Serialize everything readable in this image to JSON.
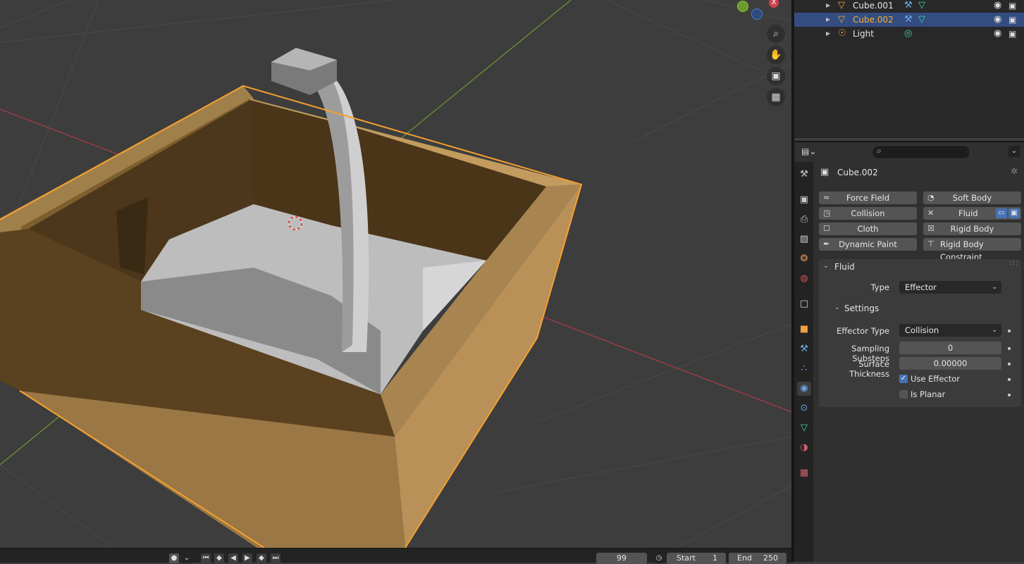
{
  "viewport": {
    "gizmo": {
      "close_label": "X"
    },
    "nav_icons": [
      "zoom-icon",
      "hand-icon",
      "camera-icon",
      "grid-icon"
    ]
  },
  "timeline": {
    "current_frame": "99",
    "start_label": "Start",
    "start_value": "1",
    "end_label": "End",
    "end_value": "250"
  },
  "outliner": {
    "items": [
      {
        "name": "Cube.001",
        "selected": false
      },
      {
        "name": "Cube.002",
        "selected": true
      },
      {
        "name": "Light",
        "selected": false
      }
    ]
  },
  "properties": {
    "object_name": "Cube.002",
    "physics_buttons": [
      {
        "label": "Force Field"
      },
      {
        "label": "Soft Body"
      },
      {
        "label": "Collision"
      },
      {
        "label": "Fluid"
      },
      {
        "label": "Cloth"
      },
      {
        "label": "Rigid Body"
      },
      {
        "label": "Dynamic Paint"
      },
      {
        "label": "Rigid Body Constraint"
      }
    ],
    "fluid_panel": {
      "title": "Fluid",
      "type_label": "Type",
      "type_value": "Effector",
      "settings_title": "Settings",
      "effector_type_label": "Effector Type",
      "effector_type_value": "Collision",
      "sampling_label": "Sampling Substeps",
      "sampling_value": "0",
      "thickness_label": "Surface Thickness",
      "thickness_value": "0.00000",
      "use_effector_label": "Use Effector",
      "use_effector_checked": true,
      "is_planar_label": "Is Planar",
      "is_planar_checked": false
    }
  },
  "colors": {
    "selection_outline": "#f5a030",
    "accent_blue": "#4772b3",
    "x_axis": "#b33c45",
    "y_axis": "#6c9a2a"
  }
}
